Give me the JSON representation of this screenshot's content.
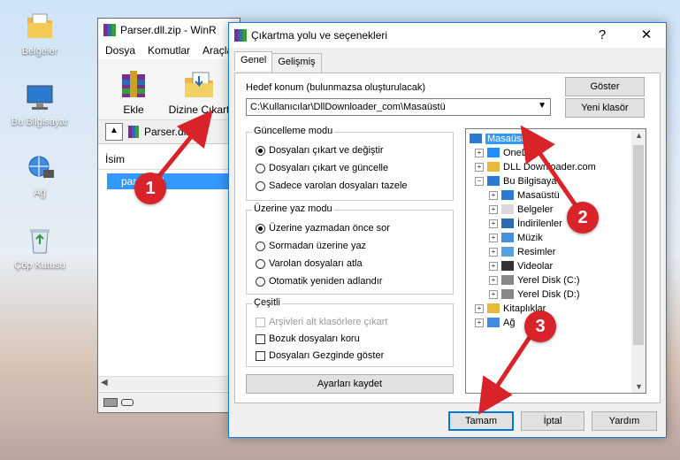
{
  "desktop": {
    "icons": [
      {
        "label": "Belgeler",
        "icon": "documents-folder-icon"
      },
      {
        "label": "Bu Bilgisayar",
        "icon": "this-pc-icon"
      },
      {
        "label": "Ağ",
        "icon": "network-icon"
      },
      {
        "label": "Çöp Kutusu",
        "icon": "recycle-bin-icon"
      }
    ]
  },
  "winrar": {
    "title": "Parser.dll.zip - WinR",
    "menu": [
      "Dosya",
      "Komutlar",
      "Araçla"
    ],
    "toolbar": [
      {
        "label": "Ekle",
        "icon": "add-archive-icon"
      },
      {
        "label": "Dizine Çıkart",
        "icon": "extract-to-icon"
      }
    ],
    "path": "Parser.dll.za",
    "column_name": "İsim",
    "file": "parser.dll"
  },
  "dialog": {
    "title": "Çıkartma yolu ve seçenekleri",
    "help": "?",
    "close": "✕",
    "tabs": [
      "Genel",
      "Gelişmiş"
    ],
    "dest_label": "Hedef konum (bulunmazsa oluşturulacak)",
    "dest_value": "C:\\Kullanıcılar\\DllDownloader_com\\Masaüstü",
    "show_btn": "Göster",
    "new_folder_btn": "Yeni klasör",
    "update_group": {
      "title": "Güncelleme modu",
      "options": [
        "Dosyaları çıkart ve değiştir",
        "Dosyaları çıkart ve güncelle",
        "Sadece varolan dosyaları tazele"
      ],
      "selected": 0
    },
    "overwrite_group": {
      "title": "Üzerine yaz modu",
      "options": [
        "Üzerine yazmadan önce sor",
        "Sormadan üzerine yaz",
        "Varolan dosyaları atla",
        "Otomatik yeniden adlandır"
      ],
      "selected": 0
    },
    "misc_group": {
      "title": "Çeşitli",
      "options": [
        "Arşivleri alt klasörlere çıkart",
        "Bozuk dosyaları koru",
        "Dosyaları Gezginde göster"
      ]
    },
    "save_settings_btn": "Ayarları kaydet",
    "tree": [
      {
        "label": "Masaüstü",
        "level": 0,
        "selected": true,
        "expander": ""
      },
      {
        "label": "OneDr",
        "level": 1,
        "expander": "+"
      },
      {
        "label": "DLL Downloader.com",
        "level": 1,
        "expander": "+"
      },
      {
        "label": "Bu Bilgisaya",
        "level": 1,
        "expander": "−"
      },
      {
        "label": "Masaüstü",
        "level": 2,
        "expander": "+"
      },
      {
        "label": "Belgeler",
        "level": 2,
        "expander": "+"
      },
      {
        "label": "İndirilenler",
        "level": 2,
        "expander": "+"
      },
      {
        "label": "Müzik",
        "level": 2,
        "expander": "+"
      },
      {
        "label": "Resimler",
        "level": 2,
        "expander": "+"
      },
      {
        "label": "Videolar",
        "level": 2,
        "expander": "+"
      },
      {
        "label": "Yerel Disk (C:)",
        "level": 2,
        "expander": "+"
      },
      {
        "label": "Yerel Disk (D:)",
        "level": 2,
        "expander": "+"
      },
      {
        "label": "Kitaplıklar",
        "level": 1,
        "expander": "+"
      },
      {
        "label": "Ağ",
        "level": 1,
        "expander": "+"
      }
    ],
    "ok_btn": "Tamam",
    "cancel_btn": "İptal",
    "help_btn": "Yardım"
  },
  "annotations": [
    "1",
    "2",
    "3"
  ],
  "colors": {
    "selection": "#3399ff",
    "annotation": "#d8232a",
    "focus": "#0078d7"
  }
}
